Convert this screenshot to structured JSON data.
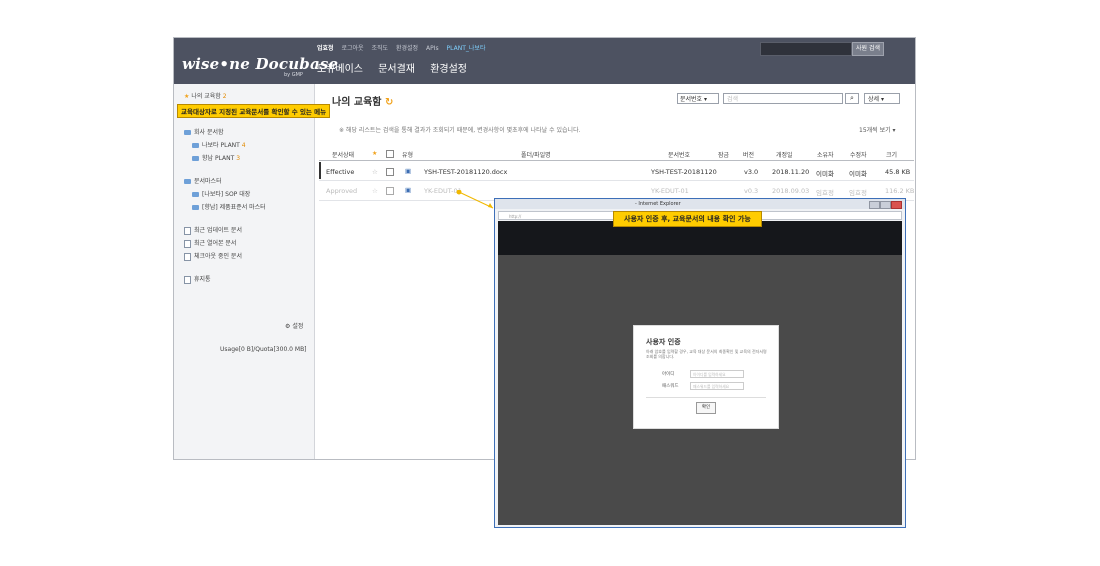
{
  "header": {
    "logo": "wise•ne Docubase",
    "logo_sub": "by GMP",
    "top_links": [
      "업효정",
      "로그아웃",
      "조직도",
      "환경설정",
      "APIs"
    ],
    "plant": "PLANT_나보타",
    "menu": [
      "도큐베이스",
      "문서결재",
      "환경설정"
    ],
    "search_button": "사원 검색"
  },
  "sidebar": {
    "my_edu": "나의 교육함",
    "my_edu_count": "2",
    "company_docs": "회사 문서함",
    "plant_naboto": "나보타 PLANT",
    "plant_naboto_count": "4",
    "plant_hyangnam": "향남 PLANT",
    "plant_hyangnam_count": "3",
    "doc_master": "문서마스터",
    "sop_ledger": "[나보타] SOP 대장",
    "product_master": "[향남] 제품표준서 마스터",
    "recent_update": "최근 업데이트 문서",
    "recent_view": "최근 열어본 문서",
    "checkout": "체크아웃 중인 문서",
    "trash": "휴지통",
    "settings": "설정",
    "usage": "Usage[0 B]/Quota[300.0 MB]"
  },
  "callouts": {
    "menu_callout": "교육대상자로 지정된 교육문서를 확인할 수 있는 메뉴",
    "popup_callout": "사용자 인증 후, 교육문서의 내용 확인 가능"
  },
  "main": {
    "title": "나의 교육함",
    "filter_select": "문서번호",
    "filter_placeholder": "검색",
    "filter_more": "상세",
    "notice": "※ 해당 리스트는 검색을 통해 결과가 조회되기 때문에, 변경사항이 몇초후에 나타날 수 있습니다.",
    "per_page": "15개씩 보기",
    "columns": [
      "문서상태",
      "유형",
      "폴더/파일명",
      "문서번호",
      "잠금",
      "버전",
      "개정일",
      "소유자",
      "수정자",
      "크기"
    ],
    "rows": [
      {
        "status": "Effective",
        "name": "YSH-TEST-20181120.docx",
        "number": "YSH-TEST-20181120",
        "version": "v3.0",
        "date": "2018.11.20",
        "owner": "이미화",
        "editor": "이미화",
        "size": "45.8 KB"
      },
      {
        "status": "Approved",
        "name": "YK-EDUT-01",
        "number": "YK-EDUT-01",
        "version": "v0.3",
        "date": "2018.09.03",
        "owner": "임효정",
        "editor": "임효정",
        "size": "116.2 KB"
      }
    ]
  },
  "popup": {
    "window_title": "- Internet Explorer",
    "address": "http://",
    "dialog_title": "사용자 인증",
    "dialog_desc": "아래 암호를 입력할 경우, 교육 대상 문서의 최종확인 및 교육의 전자서명 조회를 의합니다.",
    "id_label": "아이디",
    "id_placeholder": "아이디를 입력하세요",
    "pw_label": "패스워드",
    "pw_placeholder": "패스워드를 입력하세요",
    "confirm": "확인"
  },
  "colors": {
    "header_bg": "#4d5261",
    "callout": "#ffcc00",
    "accent": "#f1a21b"
  }
}
